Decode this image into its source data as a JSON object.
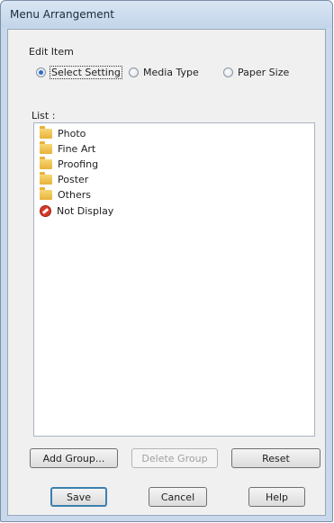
{
  "window": {
    "title": "Menu Arrangement"
  },
  "edit_item": {
    "label": "Edit Item",
    "options": [
      {
        "label": "Select Setting",
        "selected": true
      },
      {
        "label": "Media Type",
        "selected": false
      },
      {
        "label": "Paper Size",
        "selected": false
      }
    ]
  },
  "list": {
    "label": "List :",
    "items": [
      {
        "label": "Photo",
        "icon": "folder-icon"
      },
      {
        "label": "Fine Art",
        "icon": "folder-icon"
      },
      {
        "label": "Proofing",
        "icon": "folder-icon"
      },
      {
        "label": "Poster",
        "icon": "folder-icon"
      },
      {
        "label": "Others",
        "icon": "folder-icon"
      },
      {
        "label": "Not Display",
        "icon": "not-display-icon"
      }
    ]
  },
  "buttons": {
    "add_group": "Add Group...",
    "delete_group": "Delete Group",
    "reset": "Reset",
    "save": "Save",
    "cancel": "Cancel",
    "help": "Help"
  }
}
